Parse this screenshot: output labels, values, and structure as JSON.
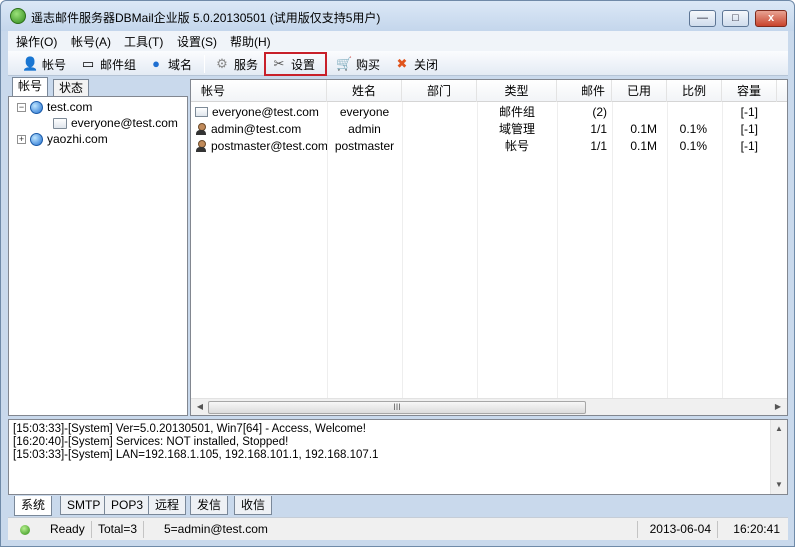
{
  "window": {
    "title": "遥志邮件服务器DBMail企业版 5.0.20130501 (试用版仅支持5用户)"
  },
  "menu": [
    {
      "label": "操作(O)"
    },
    {
      "label": "帐号(A)"
    },
    {
      "label": "工具(T)"
    },
    {
      "label": "设置(S)"
    },
    {
      "label": "帮助(H)"
    }
  ],
  "toolbar": {
    "account": "帐号",
    "mailgroup": "邮件组",
    "domain": "域名",
    "service": "服务",
    "settings": "设置",
    "buy": "购买",
    "close": "关闭"
  },
  "left_tabs": {
    "account": "帐号",
    "status": "状态"
  },
  "tree": {
    "domain1": "test.com",
    "domain1_child": "everyone@test.com",
    "domain2": "yaozhi.com",
    "collapse": "−",
    "expand": "+"
  },
  "list": {
    "columns": [
      "帐号",
      "姓名",
      "部门",
      "类型",
      "邮件",
      "已用",
      "比例",
      "容量"
    ],
    "rows": [
      {
        "account": "everyone@test.com",
        "name": "everyone",
        "dept": "",
        "type": "邮件组",
        "mail": "(2)",
        "used": "",
        "ratio": "",
        "capacity": "[-1]"
      },
      {
        "account": "admin@test.com",
        "name": "admin",
        "dept": "",
        "type": "域管理",
        "mail": "1/1",
        "used": "0.1M",
        "ratio": "0.1%",
        "capacity": "[-1]"
      },
      {
        "account": "postmaster@test.com",
        "name": "postmaster",
        "dept": "",
        "type": "帐号",
        "mail": "1/1",
        "used": "0.1M",
        "ratio": "0.1%",
        "capacity": "[-1]"
      }
    ],
    "scroll_grip": "III"
  },
  "log": [
    "[15:03:33]-[System] Ver=5.0.20130501, Win7[64] - Access, Welcome!",
    "[16:20:40]-[System] Services: NOT installed, Stopped!",
    "[15:03:33]-[System] LAN=192.168.1.105, 192.168.101.1, 192.168.107.1"
  ],
  "bottom_tabs": [
    "系统",
    "SMTP",
    "POP3",
    "远程",
    "发信",
    "收信"
  ],
  "status": {
    "ready": "Ready",
    "total": "Total=3",
    "selected": "5=admin@test.com",
    "date": "2013-06-04",
    "time": "16:20:41"
  },
  "glyphs": {
    "min": "—",
    "max": "□",
    "close": "x",
    "arrow_left": "◀",
    "arrow_right": "▶",
    "arrow_up": "▲",
    "arrow_down": "▼"
  }
}
